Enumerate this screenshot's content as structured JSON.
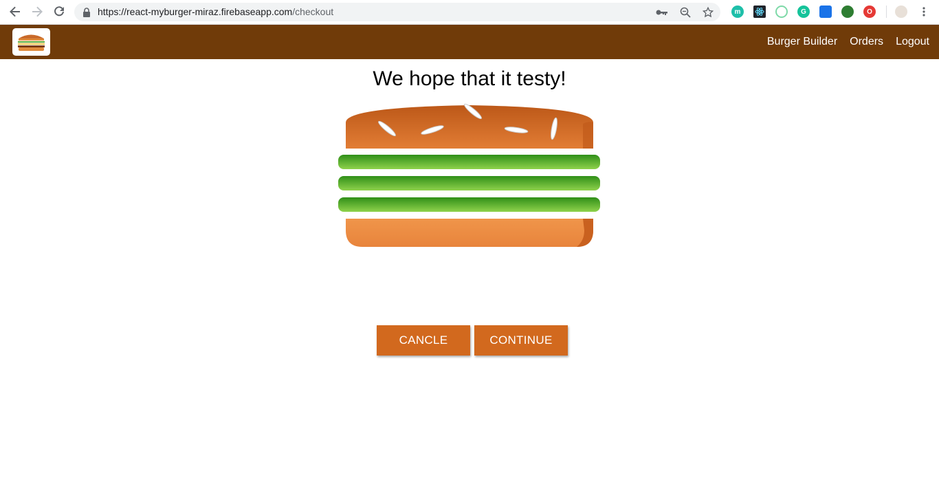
{
  "browser": {
    "url_host": "https://react-myburger-miraz.firebaseapp.com",
    "url_path": "/checkout",
    "extensions": [
      {
        "name": "m",
        "color": "#1ebfa9"
      },
      {
        "name": "react-devtools-icon",
        "color": "#20232a"
      },
      {
        "name": "color-picker-icon",
        "color": "#ffffff"
      },
      {
        "name": "grammarly-icon",
        "color": "#15c39a"
      },
      {
        "name": "screenshot-icon",
        "color": "#1a73e8"
      },
      {
        "name": "globe-extension-icon",
        "color": "#2e7d32"
      },
      {
        "name": "opera-icon",
        "color": "#e53935"
      }
    ]
  },
  "toolbar": {
    "nav": [
      {
        "label": "Burger Builder"
      },
      {
        "label": "Orders"
      },
      {
        "label": "Logout"
      }
    ],
    "background": "#703B09"
  },
  "checkout": {
    "title": "We hope that it testy!",
    "ingredients": [
      "salad",
      "salad",
      "salad"
    ],
    "cancel_label": "CANCLE",
    "continue_label": "CONTINUE",
    "button_color": "#D2691E"
  }
}
